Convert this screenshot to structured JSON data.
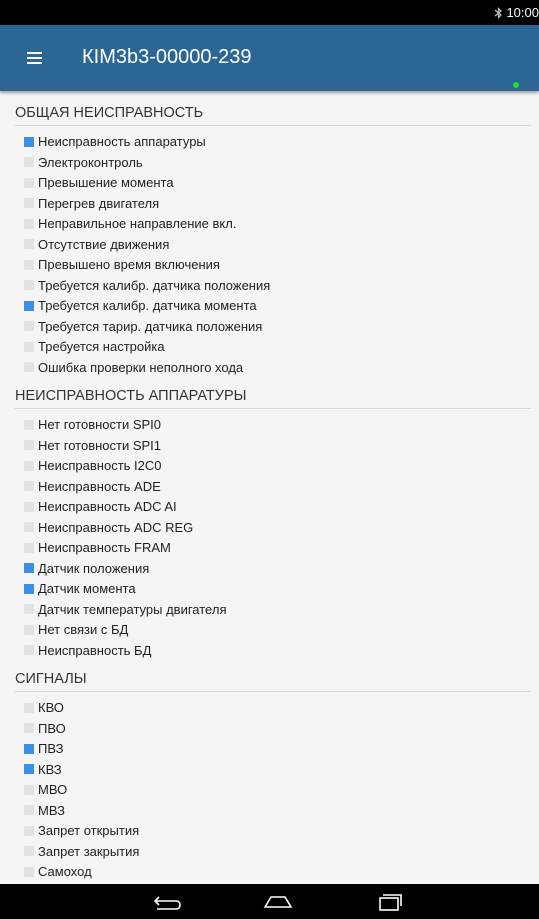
{
  "status_bar": {
    "time": "10:00",
    "bluetooth_icon": "bluetooth-icon"
  },
  "app_bar": {
    "menu_icon": "menu-icon",
    "title": "КІМ3b3-00000-239",
    "connection_indicator_color": "#25e025"
  },
  "colors": {
    "app_bar": "#2b6695",
    "active_box": "#3b8fe8",
    "inactive_box": "#e2e2e2"
  },
  "sections": [
    {
      "title": "ОБЩАЯ НЕИСПРАВНОСТЬ",
      "items": [
        {
          "label": "Неисправность аппаратуры",
          "active": true
        },
        {
          "label": "Электроконтроль",
          "active": false
        },
        {
          "label": "Превышение момента",
          "active": false
        },
        {
          "label": "Перегрев двигателя",
          "active": false
        },
        {
          "label": "Неправильное направление вкл.",
          "active": false
        },
        {
          "label": "Отсутствие движения",
          "active": false
        },
        {
          "label": "Превышено время включения",
          "active": false
        },
        {
          "label": "Требуется калибр. датчика положения",
          "active": false
        },
        {
          "label": "Требуется калибр. датчика момента",
          "active": true
        },
        {
          "label": "Требуется тарир. датчика положения",
          "active": false
        },
        {
          "label": "Требуется настройка",
          "active": false
        },
        {
          "label": "Ошибка проверки неполного хода",
          "active": false
        }
      ]
    },
    {
      "title": "НЕИСПРАВНОСТЬ АППАРАТУРЫ",
      "items": [
        {
          "label": "Нет готовности SPI0",
          "active": false
        },
        {
          "label": "Нет готовности SPI1",
          "active": false
        },
        {
          "label": "Неисправность I2C0",
          "active": false
        },
        {
          "label": "Неисправность ADE",
          "active": false
        },
        {
          "label": "Неисправность ADC AI",
          "active": false
        },
        {
          "label": "Неисправность ADC REG",
          "active": false
        },
        {
          "label": "Неисправность FRAM",
          "active": false
        },
        {
          "label": "Датчик положения",
          "active": true
        },
        {
          "label": "Датчик момента",
          "active": true
        },
        {
          "label": "Датчик температуры двигателя",
          "active": false
        },
        {
          "label": "Нет связи с БД",
          "active": false
        },
        {
          "label": "Неисправность БД",
          "active": false
        }
      ]
    },
    {
      "title": "СИГНАЛЫ",
      "items": [
        {
          "label": "КВО",
          "active": false
        },
        {
          "label": "ПВО",
          "active": false
        },
        {
          "label": "ПВЗ",
          "active": true
        },
        {
          "label": "КВЗ",
          "active": true
        },
        {
          "label": "МВО",
          "active": false
        },
        {
          "label": "МВЗ",
          "active": false
        },
        {
          "label": "Запрет открытия",
          "active": false
        },
        {
          "label": "Запрет закрытия",
          "active": false
        },
        {
          "label": "Самоход",
          "active": false
        }
      ]
    }
  ],
  "nav_bar": {
    "back_icon": "back-icon",
    "home_icon": "home-icon",
    "recents_icon": "recents-icon"
  }
}
